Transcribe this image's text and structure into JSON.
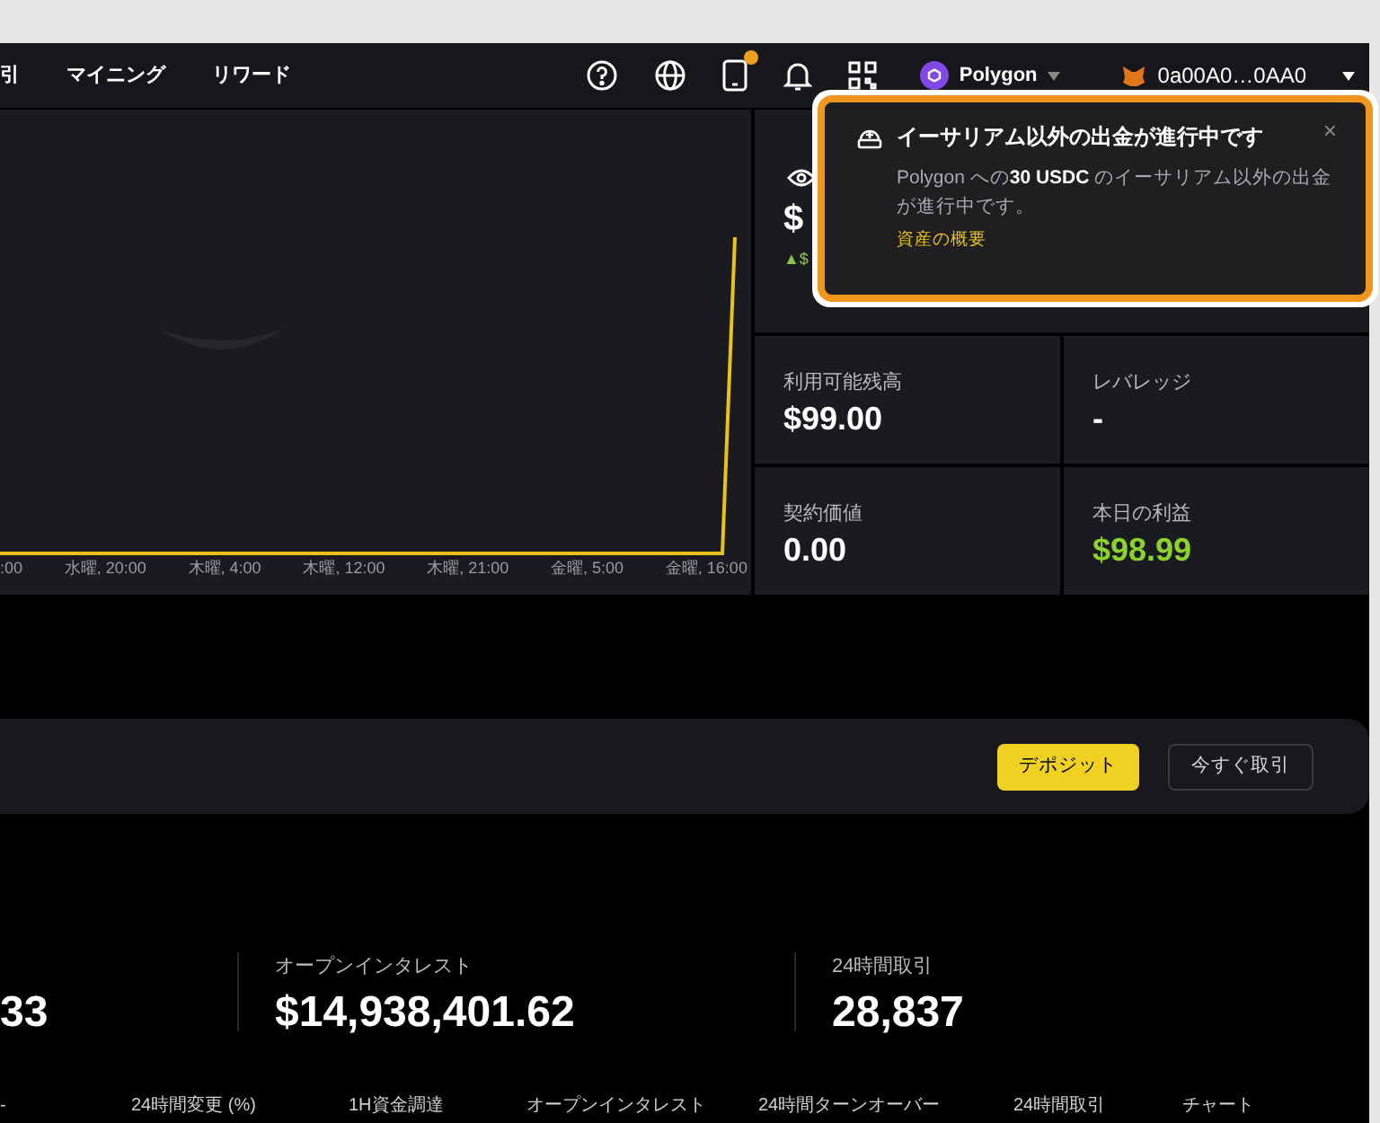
{
  "nav": {
    "items": [
      {
        "label": "引"
      },
      {
        "label": "マイニング"
      },
      {
        "label": "リワード"
      }
    ],
    "device_has_alert": true,
    "network": {
      "name": "Polygon"
    },
    "wallet": {
      "address": "0a00A0…0AA0"
    }
  },
  "chart": {
    "x_labels": [
      ":00",
      "水曜, 20:00",
      "木曜, 4:00",
      "木曜, 12:00",
      "木曜, 21:00",
      "金曜, 5:00",
      "金曜, 16:00"
    ]
  },
  "balance": {
    "value": "$",
    "change": "▲$"
  },
  "stats": [
    {
      "label": "利用可能残高",
      "value": "$99.00",
      "kind": "plain"
    },
    {
      "label": "レバレッジ",
      "value": "-",
      "kind": "plain"
    },
    {
      "label": "契約価値",
      "value": "0.00",
      "kind": "plain"
    },
    {
      "label": "本日の利益",
      "value": "$98.99",
      "kind": "profit"
    }
  ],
  "notification": {
    "title": "イーサリアム以外の出金が進行中です",
    "body": "Polygon への**30 USDC** のイーサリアム以外の出金が進行中です。",
    "link": "資産の概要",
    "close": "×"
  },
  "deposit_bar": {
    "buttons": [
      {
        "label": "デポジット",
        "kind": "primary"
      },
      {
        "label": "今すぐ取引",
        "kind": "secondary"
      }
    ]
  },
  "market_stats": [
    {
      "value": "33"
    },
    {
      "label": "オープンインタレスト",
      "value": "$14,938,401.62"
    },
    {
      "label": "24時間取引",
      "value": "28,837"
    }
  ],
  "table": {
    "columns": [
      "-",
      "24時間変更 (%)",
      "1H資金調達",
      "オープンインタレスト",
      "24時間ターンオーバー",
      "24時間取引",
      "チャート"
    ]
  }
}
